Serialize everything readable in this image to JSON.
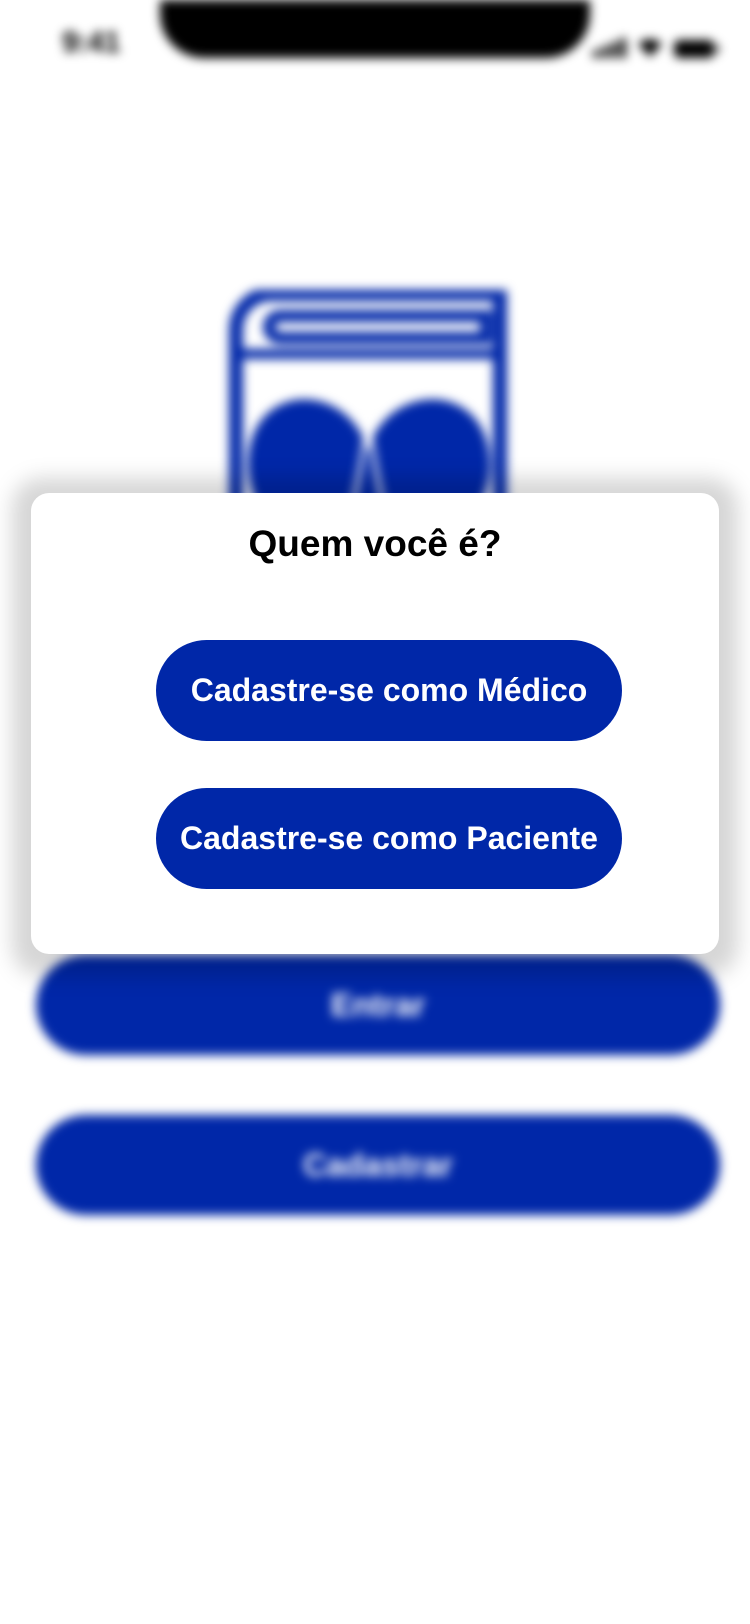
{
  "status_bar": {
    "time": "9:41"
  },
  "background": {
    "logo_icon": "book-heart-pulse-logo",
    "brand_color": "#0027a8",
    "buttons": {
      "login_label": "Entrar",
      "register_label": "Cadastrar"
    }
  },
  "modal": {
    "title": "Quem você é?",
    "options": {
      "doctor_label": "Cadastre-se como Médico",
      "patient_label": "Cadastre-se como Paciente"
    }
  }
}
